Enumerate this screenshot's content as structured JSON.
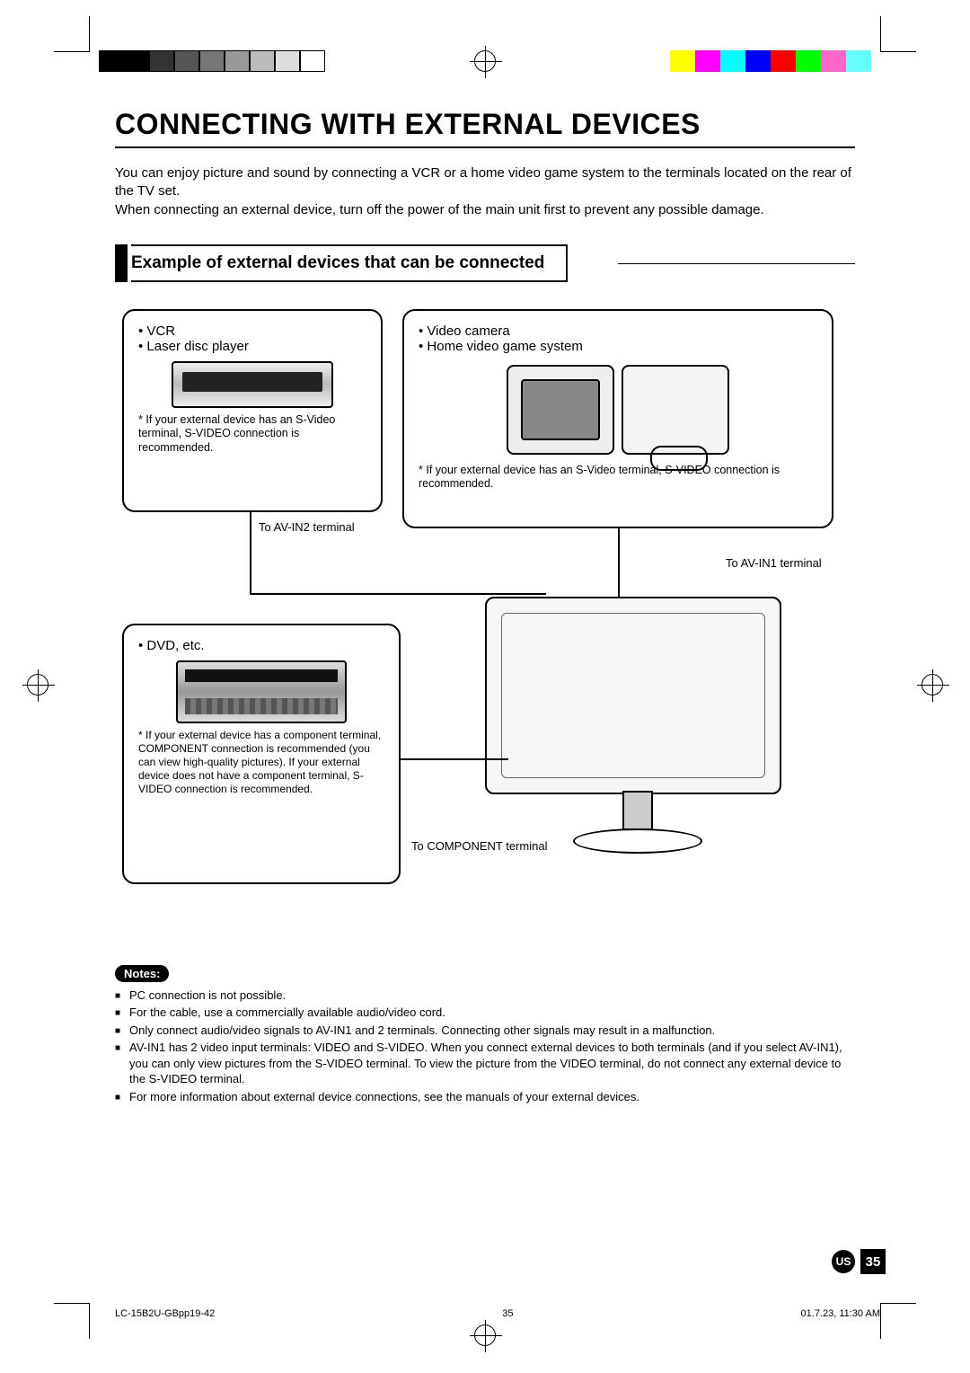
{
  "title": "CONNECTING WITH EXTERNAL DEVICES",
  "intro": "You can enjoy picture and sound by connecting a VCR or a home video game system to the terminals located on the rear of the TV set.\nWhen connecting an external device, turn off the power of the main unit first to prevent any possible damage.",
  "subhead": "Example of external devices that can be connected",
  "box_a": {
    "items": [
      "VCR",
      "Laser disc player"
    ],
    "note": "If your external device has an S-Video terminal, S-VIDEO connection is recommended."
  },
  "box_b": {
    "items": [
      "Video camera",
      "Home video game system"
    ],
    "note": "If your external device has an S-Video terminal, S-VIDEO connection is recommended."
  },
  "box_c": {
    "items": [
      "DVD, etc."
    ],
    "note": "If your external device has a component terminal, COMPONENT connection is recommended (you can view high-quality pictures). If your external device does not have a component terminal, S-VIDEO connection is recommended."
  },
  "labels": {
    "avin2": "To AV-IN2 terminal",
    "avin1": "To AV-IN1 terminal",
    "component": "To COMPONENT terminal"
  },
  "notes_badge": "Notes:",
  "notes": [
    "PC connection is not possible.",
    "For the cable, use a commercially available audio/video cord.",
    "Only connect audio/video signals to AV-IN1 and 2 terminals. Connecting other signals may result in a malfunction.",
    "AV-IN1 has 2 video input terminals: VIDEO and S-VIDEO. When you connect external devices to both terminals (and if you select AV-IN1), you can only view pictures from the S-VIDEO terminal. To view the picture from the VIDEO terminal, do not connect any external device to the S-VIDEO terminal.",
    "For more information about external device connections, see the manuals of your external devices."
  ],
  "page_badge": {
    "region": "US",
    "number": "35"
  },
  "footer": {
    "doc_id": "LC-15B2U-GBpp19-42",
    "page": "35",
    "timestamp": "01.7.23, 11:30 AM"
  },
  "colorbars": {
    "left": [
      "#000",
      "#000",
      "#333",
      "#555",
      "#777",
      "#999",
      "#bbb",
      "#ddd",
      "#fff"
    ],
    "right": [
      "#ffff00",
      "#ff00ff",
      "#00ffff",
      "#0000ff",
      "#ff0000",
      "#00ff00",
      "#ff66cc",
      "#66ffff"
    ]
  }
}
